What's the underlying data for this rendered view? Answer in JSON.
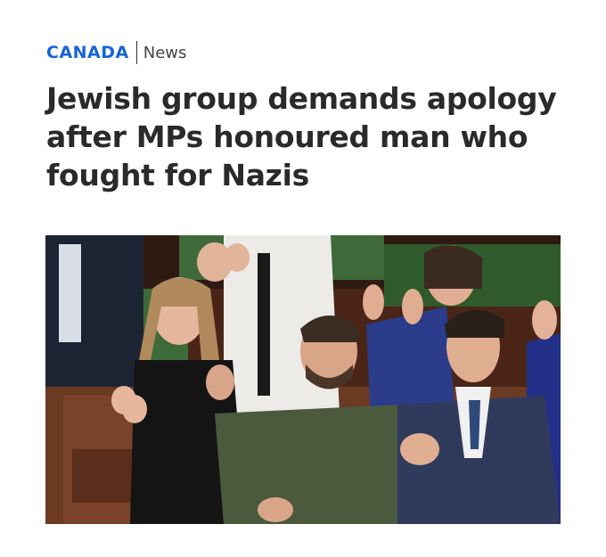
{
  "section": {
    "name": "CANADA",
    "sub": "News"
  },
  "headline": "Jewish group demands apology after MPs honoured man who fought for Nazis",
  "colors": {
    "accent": "#1565d8",
    "headline": "#2a2a2a"
  }
}
